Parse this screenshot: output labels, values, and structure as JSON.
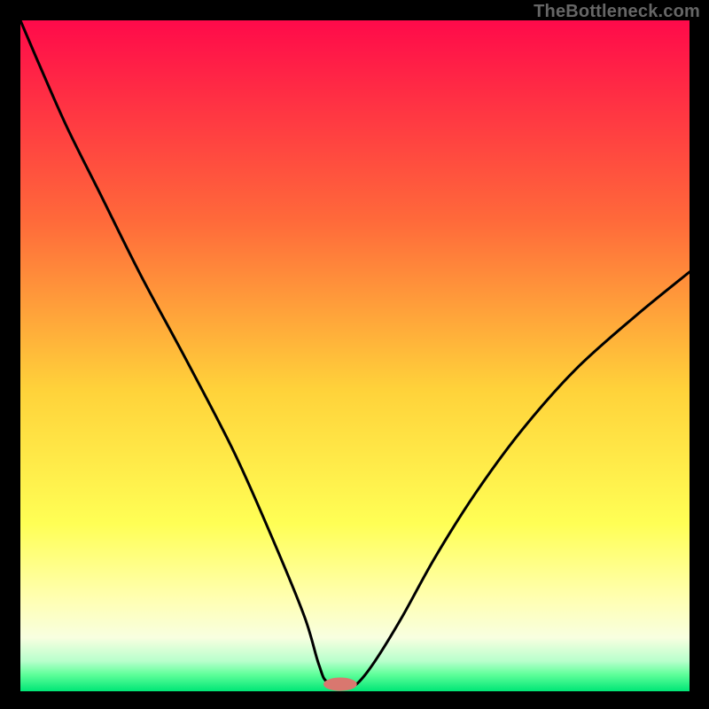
{
  "watermark": "TheBottleneck.com",
  "chart_data": {
    "type": "line",
    "title": "",
    "xlabel": "",
    "ylabel": "",
    "xlim": [
      0,
      100
    ],
    "ylim": [
      0,
      100
    ],
    "gradient_stops": [
      {
        "offset": 0.0,
        "color": "#ff0a4a"
      },
      {
        "offset": 0.3,
        "color": "#ff6a3a"
      },
      {
        "offset": 0.55,
        "color": "#ffd23a"
      },
      {
        "offset": 0.75,
        "color": "#ffff55"
      },
      {
        "offset": 0.86,
        "color": "#ffffb0"
      },
      {
        "offset": 0.92,
        "color": "#f8ffe0"
      },
      {
        "offset": 0.955,
        "color": "#b8ffcc"
      },
      {
        "offset": 0.975,
        "color": "#5fff9a"
      },
      {
        "offset": 1.0,
        "color": "#00e676"
      }
    ],
    "series": [
      {
        "name": "bottleneck-curve",
        "x": [
          0.0,
          3.0,
          7.0,
          12.0,
          18.0,
          25.0,
          32.0,
          38.0,
          42.5,
          44.6,
          46.0,
          49.5,
          50.5,
          53.0,
          57.0,
          62.0,
          68.0,
          75.0,
          83.0,
          92.0,
          100.0
        ],
        "y": [
          100.0,
          93.0,
          84.0,
          74.0,
          62.0,
          49.0,
          35.5,
          22.0,
          11.0,
          4.0,
          1.3,
          1.1,
          1.3,
          4.5,
          11.0,
          20.0,
          29.5,
          39.0,
          48.0,
          56.0,
          62.5
        ]
      }
    ],
    "marker": {
      "name": "optimal-range",
      "x": 47.8,
      "y": 1.05,
      "rx": 2.5,
      "ry": 1.0,
      "color": "#d9776f"
    }
  }
}
